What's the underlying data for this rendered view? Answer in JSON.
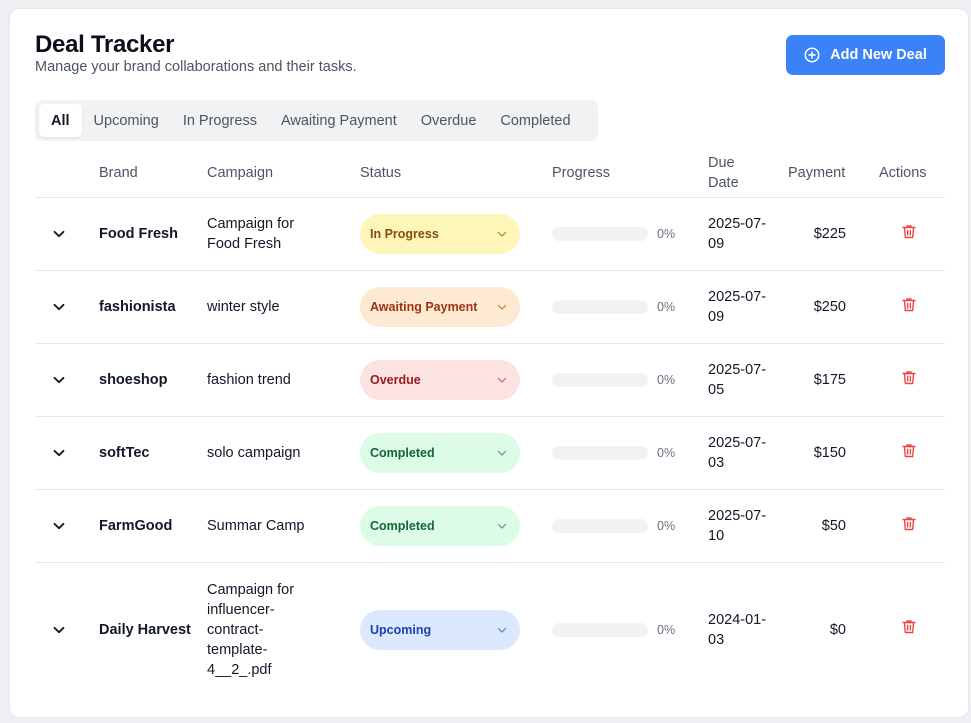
{
  "header": {
    "title": "Deal Tracker",
    "subtitle": "Manage your brand collaborations and their tasks.",
    "add_button_label": "Add New Deal",
    "add_button_icon": "plus-circle-icon"
  },
  "tabs": [
    "All",
    "Upcoming",
    "In Progress",
    "Awaiting Payment",
    "Overdue",
    "Completed"
  ],
  "active_tab": "All",
  "columns": {
    "brand": "Brand",
    "campaign": "Campaign",
    "status": "Status",
    "progress": "Progress",
    "due_date": "Due Date",
    "payment": "Payment",
    "actions": "Actions"
  },
  "status_styles": {
    "In Progress": {
      "bg": "#fef6b8",
      "fg": "#854d0e",
      "arrow": "#b59a2a"
    },
    "Awaiting Payment": {
      "bg": "#feead3",
      "fg": "#9a3412",
      "arrow": "#c98a55"
    },
    "Overdue": {
      "bg": "#fde2e2",
      "fg": "#991b1b",
      "arrow": "#c77a7a"
    },
    "Completed": {
      "bg": "#dcfce7",
      "fg": "#166534",
      "arrow": "#6ba87f"
    },
    "Upcoming": {
      "bg": "#dbe8fe",
      "fg": "#1e40af",
      "arrow": "#6f8fd1"
    }
  },
  "colors": {
    "accent": "#3b82f6",
    "delete": "#ef4444"
  },
  "deals": [
    {
      "brand": "Food Fresh",
      "campaign": "Campaign for Food Fresh",
      "status": "In Progress",
      "progress": "0%",
      "due_date": "2025-07-09",
      "payment": "$225"
    },
    {
      "brand": "fashionista",
      "campaign": "winter style",
      "status": "Awaiting Payment",
      "progress": "0%",
      "due_date": "2025-07-09",
      "payment": "$250"
    },
    {
      "brand": "shoeshop",
      "campaign": "fashion trend",
      "status": "Overdue",
      "progress": "0%",
      "due_date": "2025-07-05",
      "payment": "$175"
    },
    {
      "brand": "softTec",
      "campaign": "solo campaign",
      "status": "Completed",
      "progress": "0%",
      "due_date": "2025-07-03",
      "payment": "$150"
    },
    {
      "brand": "FarmGood",
      "campaign": "Summar Camp",
      "status": "Completed",
      "progress": "0%",
      "due_date": "2025-07-10",
      "payment": "$50"
    },
    {
      "brand": "Daily Harvest",
      "campaign": "Campaign for influencer-contract-template-4__2_.pdf",
      "status": "Upcoming",
      "progress": "0%",
      "due_date": "2024-01-03",
      "payment": "$0"
    }
  ]
}
